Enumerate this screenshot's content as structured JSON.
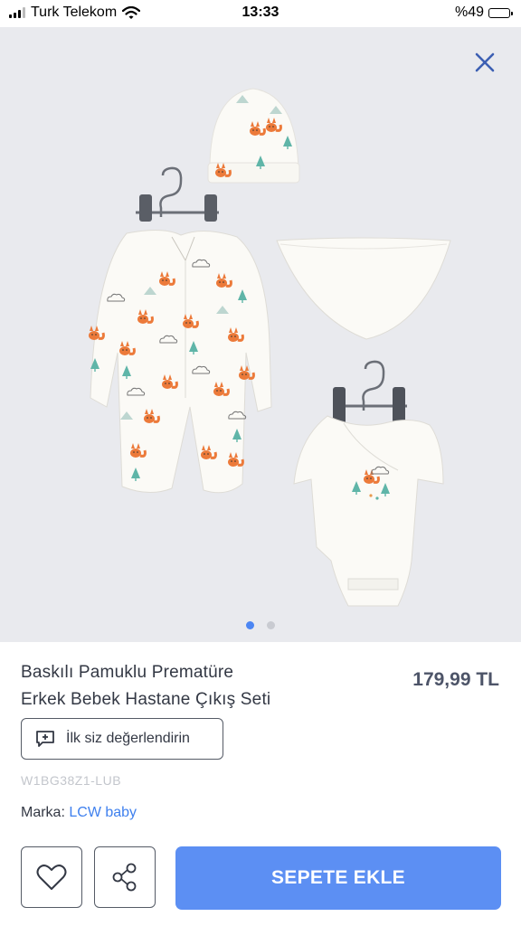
{
  "status_bar": {
    "carrier": "Turk Telekom",
    "time": "13:33",
    "battery_label": "%49",
    "battery_level": 0.49
  },
  "gallery": {
    "image_count": 2,
    "active_index": 0
  },
  "product": {
    "title_line1": "Baskılı Pamuklu Prematüre",
    "title_line2": "Erkek Bebek Hastane Çıkış Seti",
    "price": "179,99 TL",
    "review_button_label": "İlk siz değerlendirin",
    "sku": "W1BG38Z1-LUB",
    "brand_label": "Marka:",
    "brand_name": "LCW baby"
  },
  "actions": {
    "add_to_cart_label": "SEPETE EKLE"
  },
  "colors": {
    "accent": "#5c8ff3",
    "link": "#3f80ee",
    "gallery_bg": "#e9eaee",
    "fox": "#ec7a3a",
    "tree": "#5fb5a8"
  },
  "icons": [
    "wifi-icon",
    "close-icon",
    "comment-plus-icon",
    "heart-icon",
    "share-icon"
  ]
}
